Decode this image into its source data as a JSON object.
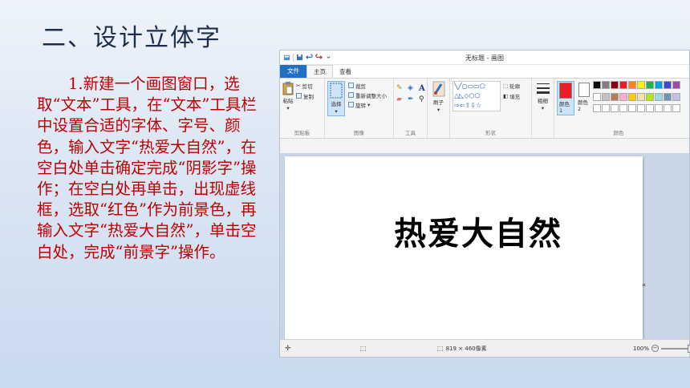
{
  "slide": {
    "title": "二、设计立体字",
    "body": "1.新建一个画图窗口，选取“文本”工具，在“文本”工具栏中设置合适的字体、字号、颜色，输入文字“热爱大自然”，在空白处单击确定完成“阴影字”操作；在空白处再单击，出现虚线框，选取“红色”作为前景色，再输入文字“热爱大自然”，单击空白处，完成“前景字”操作。"
  },
  "paint": {
    "window_title": "无标题 - 画图",
    "tabs": [
      {
        "label": "文件"
      },
      {
        "label": "主页"
      },
      {
        "label": "查看"
      }
    ],
    "ribbon": {
      "clipboard": {
        "paste": "粘贴",
        "cut": "剪切",
        "copy": "复制",
        "label": "剪贴板"
      },
      "image": {
        "select": "选择",
        "crop": "裁剪",
        "resize": "重新调整大小",
        "rotate": "旋转",
        "label": "图像"
      },
      "tools": {
        "label": "工具"
      },
      "brushes": {
        "label": "刷子"
      },
      "shapes": {
        "outline": "轮廓",
        "fill": "填充",
        "label": "形状"
      },
      "size": {
        "label": "粗细"
      },
      "colors": {
        "color1": "颜色 1",
        "color2": "颜色 2",
        "label": "颜色",
        "color1_value": "#e8202a",
        "color2_value": "#ffffff",
        "palette_row1": [
          "#000000",
          "#7f7f7f",
          "#880015",
          "#ed1c24",
          "#ff7f27",
          "#fff200",
          "#22b14c",
          "#00a2e8",
          "#3f48cc",
          "#a349a4"
        ],
        "palette_row2": [
          "#ffffff",
          "#c3c3c3",
          "#b97a57",
          "#ffaec9",
          "#ffc90e",
          "#efe4b0",
          "#b5e61d",
          "#99d9ea",
          "#7092be",
          "#c8bfe7"
        ],
        "palette_row3": [
          "#ffffff",
          "#ffffff",
          "#ffffff",
          "#ffffff",
          "#ffffff",
          "#ffffff",
          "#ffffff",
          "#ffffff",
          "#ffffff",
          "#ffffff"
        ]
      }
    },
    "canvas_text": "热爱大自然",
    "status": {
      "dimensions": "819 × 460像素",
      "zoom": "100%"
    }
  }
}
